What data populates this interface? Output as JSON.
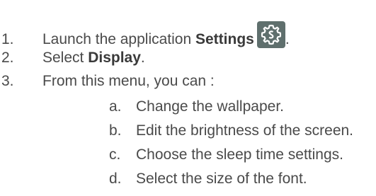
{
  "steps": [
    {
      "number": "1.",
      "text": "Launch the application ",
      "bold": "Settings",
      "icon": "settings-gear-icon",
      "suffix": "."
    },
    {
      "number": "2.",
      "text": "Select ",
      "bold": "Display",
      "suffix": "."
    },
    {
      "number": "3.",
      "text": "From this menu, you can :",
      "substeps": [
        {
          "letter": "a.",
          "text": "Change the wallpaper."
        },
        {
          "letter": "b.",
          "text": "Edit the brightness of the screen."
        },
        {
          "letter": "c.",
          "text": "Choose the sleep time settings."
        },
        {
          "letter": "d.",
          "text": "Select the size of the font."
        }
      ]
    }
  ]
}
